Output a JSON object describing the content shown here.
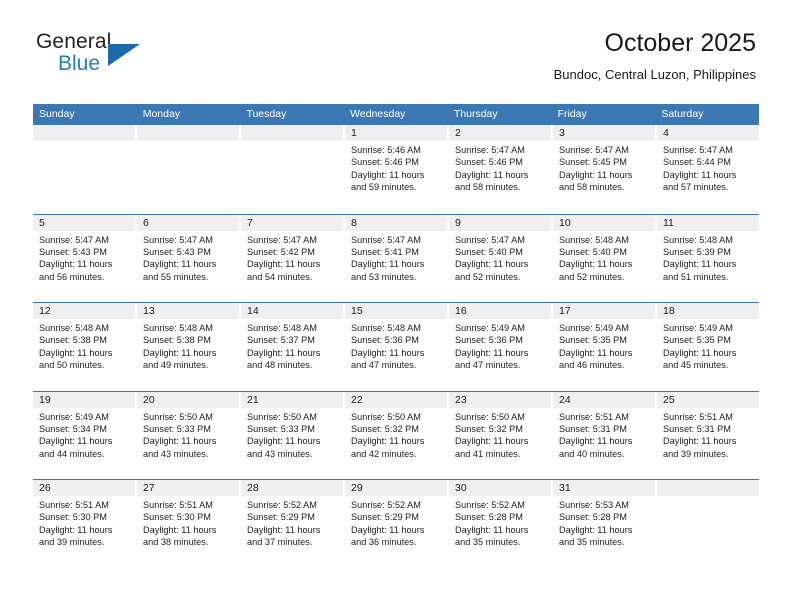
{
  "brand": {
    "name_part1": "General",
    "name_part2": "Blue",
    "flag_icon": "triangle-flag-icon"
  },
  "header": {
    "title": "October 2025",
    "subtitle": "Bundoc, Central Luzon, Philippines"
  },
  "calendar": {
    "accent_color": "#3b78b4",
    "daynum_bg": "#efefef",
    "weekdays": [
      "Sunday",
      "Monday",
      "Tuesday",
      "Wednesday",
      "Thursday",
      "Friday",
      "Saturday"
    ],
    "weeks": [
      [
        {
          "day": "",
          "empty": true
        },
        {
          "day": "",
          "empty": true
        },
        {
          "day": "",
          "empty": true
        },
        {
          "day": "1",
          "sunrise": "Sunrise: 5:46 AM",
          "sunset": "Sunset: 5:46 PM",
          "daylight_1": "Daylight: 11 hours",
          "daylight_2": "and 59 minutes."
        },
        {
          "day": "2",
          "sunrise": "Sunrise: 5:47 AM",
          "sunset": "Sunset: 5:46 PM",
          "daylight_1": "Daylight: 11 hours",
          "daylight_2": "and 58 minutes."
        },
        {
          "day": "3",
          "sunrise": "Sunrise: 5:47 AM",
          "sunset": "Sunset: 5:45 PM",
          "daylight_1": "Daylight: 11 hours",
          "daylight_2": "and 58 minutes."
        },
        {
          "day": "4",
          "sunrise": "Sunrise: 5:47 AM",
          "sunset": "Sunset: 5:44 PM",
          "daylight_1": "Daylight: 11 hours",
          "daylight_2": "and 57 minutes."
        }
      ],
      [
        {
          "day": "5",
          "sunrise": "Sunrise: 5:47 AM",
          "sunset": "Sunset: 5:43 PM",
          "daylight_1": "Daylight: 11 hours",
          "daylight_2": "and 56 minutes."
        },
        {
          "day": "6",
          "sunrise": "Sunrise: 5:47 AM",
          "sunset": "Sunset: 5:43 PM",
          "daylight_1": "Daylight: 11 hours",
          "daylight_2": "and 55 minutes."
        },
        {
          "day": "7",
          "sunrise": "Sunrise: 5:47 AM",
          "sunset": "Sunset: 5:42 PM",
          "daylight_1": "Daylight: 11 hours",
          "daylight_2": "and 54 minutes."
        },
        {
          "day": "8",
          "sunrise": "Sunrise: 5:47 AM",
          "sunset": "Sunset: 5:41 PM",
          "daylight_1": "Daylight: 11 hours",
          "daylight_2": "and 53 minutes."
        },
        {
          "day": "9",
          "sunrise": "Sunrise: 5:47 AM",
          "sunset": "Sunset: 5:40 PM",
          "daylight_1": "Daylight: 11 hours",
          "daylight_2": "and 52 minutes."
        },
        {
          "day": "10",
          "sunrise": "Sunrise: 5:48 AM",
          "sunset": "Sunset: 5:40 PM",
          "daylight_1": "Daylight: 11 hours",
          "daylight_2": "and 52 minutes."
        },
        {
          "day": "11",
          "sunrise": "Sunrise: 5:48 AM",
          "sunset": "Sunset: 5:39 PM",
          "daylight_1": "Daylight: 11 hours",
          "daylight_2": "and 51 minutes."
        }
      ],
      [
        {
          "day": "12",
          "sunrise": "Sunrise: 5:48 AM",
          "sunset": "Sunset: 5:38 PM",
          "daylight_1": "Daylight: 11 hours",
          "daylight_2": "and 50 minutes."
        },
        {
          "day": "13",
          "sunrise": "Sunrise: 5:48 AM",
          "sunset": "Sunset: 5:38 PM",
          "daylight_1": "Daylight: 11 hours",
          "daylight_2": "and 49 minutes."
        },
        {
          "day": "14",
          "sunrise": "Sunrise: 5:48 AM",
          "sunset": "Sunset: 5:37 PM",
          "daylight_1": "Daylight: 11 hours",
          "daylight_2": "and 48 minutes."
        },
        {
          "day": "15",
          "sunrise": "Sunrise: 5:48 AM",
          "sunset": "Sunset: 5:36 PM",
          "daylight_1": "Daylight: 11 hours",
          "daylight_2": "and 47 minutes."
        },
        {
          "day": "16",
          "sunrise": "Sunrise: 5:49 AM",
          "sunset": "Sunset: 5:36 PM",
          "daylight_1": "Daylight: 11 hours",
          "daylight_2": "and 47 minutes."
        },
        {
          "day": "17",
          "sunrise": "Sunrise: 5:49 AM",
          "sunset": "Sunset: 5:35 PM",
          "daylight_1": "Daylight: 11 hours",
          "daylight_2": "and 46 minutes."
        },
        {
          "day": "18",
          "sunrise": "Sunrise: 5:49 AM",
          "sunset": "Sunset: 5:35 PM",
          "daylight_1": "Daylight: 11 hours",
          "daylight_2": "and 45 minutes."
        }
      ],
      [
        {
          "day": "19",
          "sunrise": "Sunrise: 5:49 AM",
          "sunset": "Sunset: 5:34 PM",
          "daylight_1": "Daylight: 11 hours",
          "daylight_2": "and 44 minutes."
        },
        {
          "day": "20",
          "sunrise": "Sunrise: 5:50 AM",
          "sunset": "Sunset: 5:33 PM",
          "daylight_1": "Daylight: 11 hours",
          "daylight_2": "and 43 minutes."
        },
        {
          "day": "21",
          "sunrise": "Sunrise: 5:50 AM",
          "sunset": "Sunset: 5:33 PM",
          "daylight_1": "Daylight: 11 hours",
          "daylight_2": "and 43 minutes."
        },
        {
          "day": "22",
          "sunrise": "Sunrise: 5:50 AM",
          "sunset": "Sunset: 5:32 PM",
          "daylight_1": "Daylight: 11 hours",
          "daylight_2": "and 42 minutes."
        },
        {
          "day": "23",
          "sunrise": "Sunrise: 5:50 AM",
          "sunset": "Sunset: 5:32 PM",
          "daylight_1": "Daylight: 11 hours",
          "daylight_2": "and 41 minutes."
        },
        {
          "day": "24",
          "sunrise": "Sunrise: 5:51 AM",
          "sunset": "Sunset: 5:31 PM",
          "daylight_1": "Daylight: 11 hours",
          "daylight_2": "and 40 minutes."
        },
        {
          "day": "25",
          "sunrise": "Sunrise: 5:51 AM",
          "sunset": "Sunset: 5:31 PM",
          "daylight_1": "Daylight: 11 hours",
          "daylight_2": "and 39 minutes."
        }
      ],
      [
        {
          "day": "26",
          "sunrise": "Sunrise: 5:51 AM",
          "sunset": "Sunset: 5:30 PM",
          "daylight_1": "Daylight: 11 hours",
          "daylight_2": "and 39 minutes."
        },
        {
          "day": "27",
          "sunrise": "Sunrise: 5:51 AM",
          "sunset": "Sunset: 5:30 PM",
          "daylight_1": "Daylight: 11 hours",
          "daylight_2": "and 38 minutes."
        },
        {
          "day": "28",
          "sunrise": "Sunrise: 5:52 AM",
          "sunset": "Sunset: 5:29 PM",
          "daylight_1": "Daylight: 11 hours",
          "daylight_2": "and 37 minutes."
        },
        {
          "day": "29",
          "sunrise": "Sunrise: 5:52 AM",
          "sunset": "Sunset: 5:29 PM",
          "daylight_1": "Daylight: 11 hours",
          "daylight_2": "and 36 minutes."
        },
        {
          "day": "30",
          "sunrise": "Sunrise: 5:52 AM",
          "sunset": "Sunset: 5:28 PM",
          "daylight_1": "Daylight: 11 hours",
          "daylight_2": "and 35 minutes."
        },
        {
          "day": "31",
          "sunrise": "Sunrise: 5:53 AM",
          "sunset": "Sunset: 5:28 PM",
          "daylight_1": "Daylight: 11 hours",
          "daylight_2": "and 35 minutes."
        },
        {
          "day": "",
          "empty": true
        }
      ]
    ]
  }
}
